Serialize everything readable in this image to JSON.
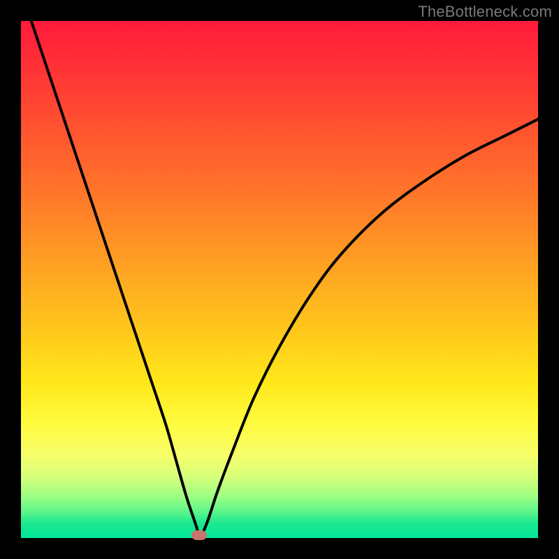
{
  "watermark": "TheBottleneck.com",
  "chart_data": {
    "type": "line",
    "title": "",
    "xlabel": "",
    "ylabel": "",
    "xlim": [
      0,
      100
    ],
    "ylim": [
      0,
      100
    ],
    "grid": false,
    "legend": false,
    "gradient": {
      "top": "#ff1a3c",
      "bottom": "#00e69a",
      "meaning": "red=high bottleneck, green=low bottleneck"
    },
    "series": [
      {
        "name": "bottleneck-curve",
        "color": "#000000",
        "x": [
          2,
          5,
          10,
          15,
          20,
          25,
          28,
          30,
          32,
          34,
          34.5,
          36,
          38,
          41,
          45,
          50,
          56,
          62,
          70,
          78,
          86,
          94,
          100
        ],
        "values": [
          100,
          91,
          76,
          61,
          46,
          31,
          22,
          15,
          8,
          2,
          0,
          3,
          9,
          17,
          27,
          37,
          47,
          55,
          63,
          69,
          74,
          78,
          81
        ]
      }
    ],
    "annotations": [
      {
        "name": "minimum-marker",
        "x": 34.5,
        "y": 0.6,
        "color": "#c9756e"
      }
    ]
  }
}
